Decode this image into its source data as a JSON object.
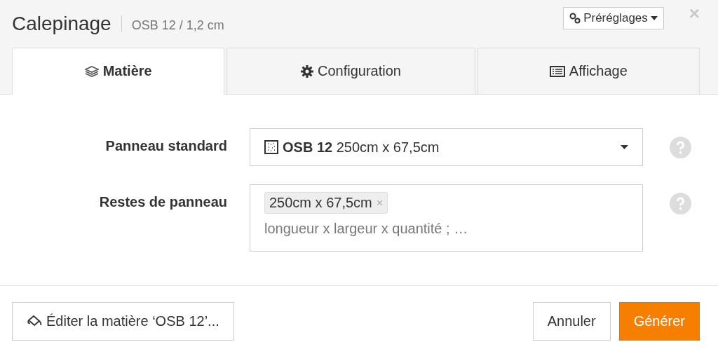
{
  "header": {
    "title": "Calepinage",
    "subtitle": "OSB 12 / 1,2 cm",
    "presets_button": "Préréglages",
    "close": "×"
  },
  "tabs": [
    {
      "label": "Matière",
      "selected": true,
      "kind": "layers"
    },
    {
      "label": "Configuration",
      "selected": false,
      "kind": "gear"
    },
    {
      "label": "Affichage",
      "selected": false,
      "kind": "list"
    }
  ],
  "form": {
    "panel": {
      "label": "Panneau standard",
      "value": "**OSB 12** 250cm x 67,5cm"
    },
    "leftovers": {
      "label": "Restes de panneau",
      "tags": [
        {
          "text": "250cm x 67,5cm",
          "remove": "×"
        }
      ],
      "placeholder": "longueur x largeur x quantité ; …"
    }
  },
  "footer": {
    "edit_button": "Éditer la matière ‘OSB 12’...",
    "cancel_button": "Annuler",
    "generate_button": "Générer"
  }
}
